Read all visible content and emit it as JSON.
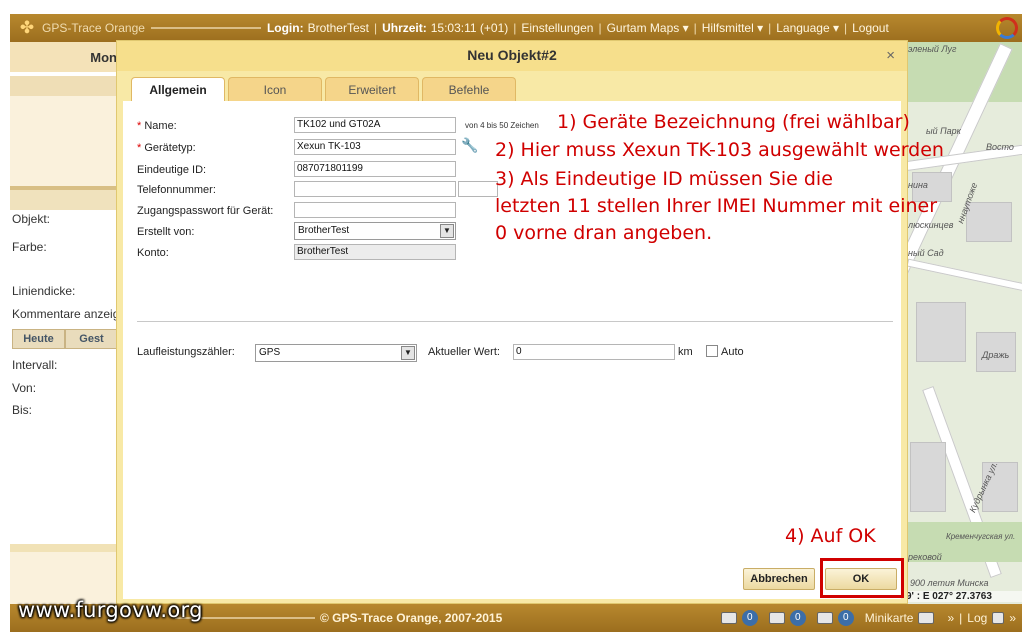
{
  "topbar": {
    "app_title": "GPS-Trace Orange",
    "login_label": "Login:",
    "login_user": "BrotherTest",
    "time_label": "Uhrzeit:",
    "time_value": "15:03:11 (+01)",
    "menu": [
      "Einstellungen",
      "Gurtam Maps ▾",
      "Hilfsmittel ▾",
      "Language ▾",
      "Logout"
    ]
  },
  "left_panel": {
    "header": "Mon",
    "labels": {
      "objekt": "Objekt:",
      "farbe": "Farbe:",
      "liniendicke": "Liniendicke:",
      "kommentare": "Kommentare anzeig",
      "intervall": "Intervall:",
      "von": "Von:",
      "bis": "Bis:"
    },
    "tabs": [
      "Heute",
      "Gest"
    ]
  },
  "dialog": {
    "title": "Neu Objekt#2",
    "close": "×",
    "tabs": [
      "Allgemein",
      "Icon",
      "Erweitert",
      "Befehle"
    ],
    "fields": {
      "name_label": "Name:",
      "name_value": "TK102 und GT02A",
      "name_hint": "von 4 bis 50 Zeichen",
      "geraetetyp_label": "Gerätetyp:",
      "geraetetyp_value": "Xexun TK-103",
      "id_label": "Eindeutige ID:",
      "id_value": "087071801199",
      "telefon_label": "Telefonnummer:",
      "passwort_label": "Zugangspasswort für Gerät:",
      "erstellt_label": "Erstellt von:",
      "erstellt_value": "BrotherTest",
      "konto_label": "Konto:",
      "konto_value": "BrotherTest",
      "laufleistung_label": "Laufleistungszähler:",
      "laufleistung_value": "GPS",
      "aktueller_label": "Aktueller Wert:",
      "aktueller_value": "0",
      "unit": "km",
      "auto_label": "Auto"
    },
    "buttons": {
      "cancel": "Abbrechen",
      "ok": "OK"
    }
  },
  "annotations": {
    "a1": "1) Geräte Bezeichnung (frei wählbar)",
    "a2": "2) Hier muss Xexun TK-103 ausgewählt werden",
    "a3_lines": [
      "3) Als Eindeutige ID müssen Sie die",
      "letzten 11 stellen Ihrer IMEI Nummer mit einer",
      "0 vorne dran angeben."
    ],
    "a4": "4) Auf OK"
  },
  "map": {
    "labels": [
      "эленый Луг",
      "ый Парк",
      "Восто",
      "нина",
      "ннаутоже",
      "люскинцев",
      "ный Сад",
      "Дражь",
      "Кудрынка ул.",
      "рековой",
      "Кременчугская ул.",
      "900 летия Минска"
    ],
    "coords": "9' : E 027° 27.3763"
  },
  "footer": {
    "copyright": "© GPS-Trace Orange, 2007-2015",
    "badges": [
      "0",
      "0",
      "0"
    ],
    "minikarte": "Minikarte",
    "log": "Log"
  },
  "watermark": "www.furgovw.org"
}
